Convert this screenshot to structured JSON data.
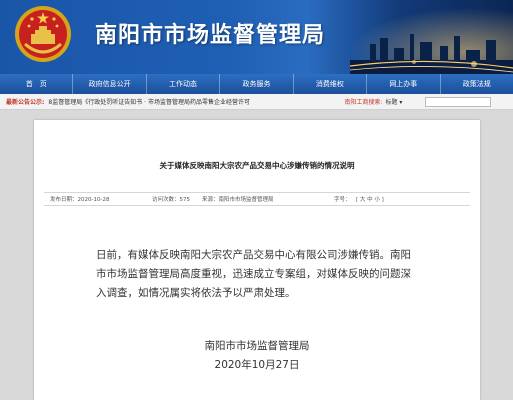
{
  "header": {
    "site_title": "南阳市市场监督管理局"
  },
  "nav": {
    "items": [
      "首　页",
      "政府信息公开",
      "工作动态",
      "政务服务",
      "消费维权",
      "网上办事",
      "政策法规"
    ]
  },
  "notice": {
    "label": "最新公告公示:",
    "ticker": "8监督管理局《行政处罚听证告知书 · 市场监督管理局药品零售企业经营许可",
    "search_label": "南阳工商搜索:",
    "search_select": "标题 ▾",
    "search_input_value": ""
  },
  "article": {
    "title": "关于媒体反映南阳大宗农产品交易中心涉嫌传销的情况说明",
    "meta": {
      "published": "发布日期：2020-10-28",
      "views": "访问次数：575",
      "source": "来源：南阳市市场监督管理局",
      "font_label": "字号：",
      "font_sizes": "[ 大 中 小 ]"
    },
    "body": "日前，有媒体反映南阳大宗农产品交易中心有限公司涉嫌传销。南阳市市场监督管理局高度重视，迅速成立专案组，对媒体反映的问题深入调查，如情况属实将依法予以严肃处理。",
    "signature_org": "南阳市市场监督管理局",
    "signature_date": "2020年10月27日"
  },
  "colors": {
    "nav_blue": "#1b4f9a",
    "header_blue": "#1f5fb4",
    "notice_red": "#c0392b"
  }
}
